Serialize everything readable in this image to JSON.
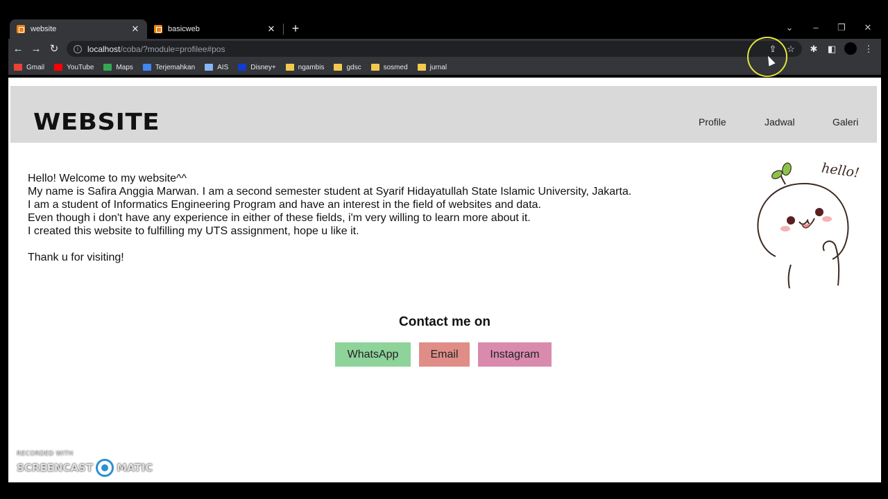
{
  "browser": {
    "tabs": [
      {
        "title": "website",
        "active": true
      },
      {
        "title": "basicweb",
        "active": false
      }
    ],
    "new_tab": "+",
    "url_host": "localhost",
    "url_path": "/coba/?module=profilee#pos",
    "bookmarks": [
      {
        "label": "Gmail",
        "icon": "gmail-icon",
        "color": "#ea4335"
      },
      {
        "label": "YouTube",
        "icon": "youtube-icon",
        "color": "#ff0000"
      },
      {
        "label": "Maps",
        "icon": "maps-icon",
        "color": "#34a853"
      },
      {
        "label": "Terjemahkan",
        "icon": "translate-icon",
        "color": "#4285f4"
      },
      {
        "label": "AIS",
        "icon": "ais-icon",
        "color": "#8ab4f8"
      },
      {
        "label": "Disney+",
        "icon": "disney-icon",
        "color": "#113ccf"
      },
      {
        "label": "ngambis",
        "icon": "folder-icon",
        "color": "#f2c94c"
      },
      {
        "label": "gdsc",
        "icon": "folder-icon",
        "color": "#f2c94c"
      },
      {
        "label": "sosmed",
        "icon": "folder-icon",
        "color": "#f2c94c"
      },
      {
        "label": "jurnal",
        "icon": "folder-icon",
        "color": "#f2c94c"
      }
    ]
  },
  "site": {
    "logo": "WEBSITE",
    "nav": [
      "Profile",
      "Jadwal",
      "Galeri"
    ],
    "intro": [
      "Hello! Welcome to my website^^",
      "My name is Safira Anggia Marwan. I am a second semester student at Syarif Hidayatullah State Islamic University, Jakarta.",
      "I am a student of Informatics Engineering Program and have an interest in the field of websites and data.",
      "Even though i don't have any experience in either of these fields, i'm very willing to learn more about it.",
      "I created this website to fulfilling my UTS assignment, hope u like it."
    ],
    "thanks": "Thank u for visiting!",
    "mascot_text": "hello!",
    "contact_title": "Contact me on",
    "contact_buttons": [
      {
        "label": "WhatsApp",
        "color": "#8ed39a"
      },
      {
        "label": "Email",
        "color": "#e08d88"
      },
      {
        "label": "Instagram",
        "color": "#d98aad"
      }
    ]
  },
  "watermark": {
    "line1": "RECORDED WITH",
    "line2a": "SCREENCAST",
    "line2b": "MATIC"
  }
}
